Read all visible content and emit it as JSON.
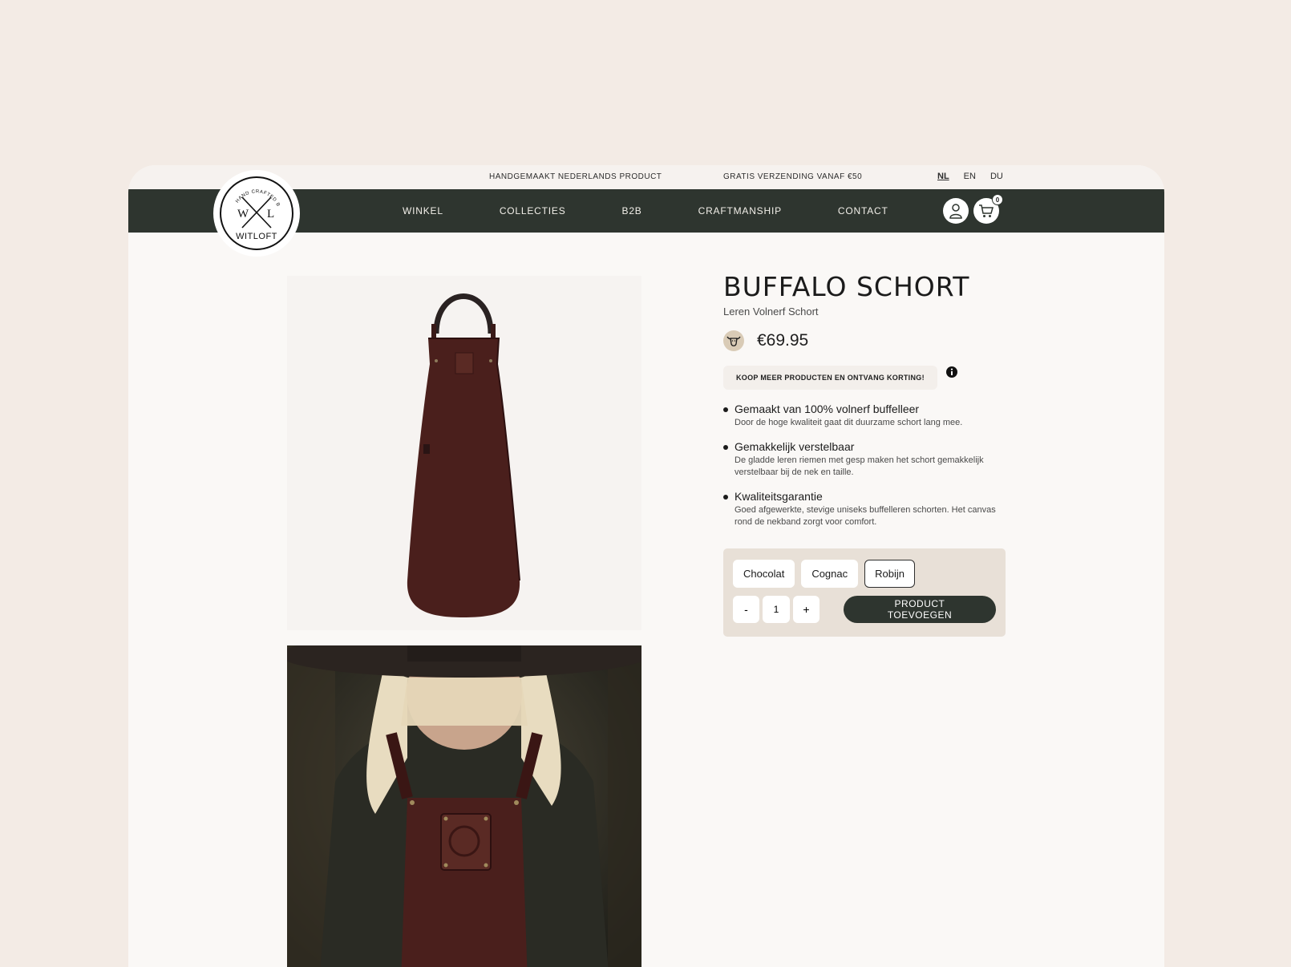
{
  "topbar": {
    "message_1": "HANDGEMAAKT NEDERLANDS PRODUCT",
    "message_2": "GRATIS VERZENDING VANAF €50",
    "languages": [
      "NL",
      "EN",
      "DU"
    ],
    "active_language": "NL"
  },
  "logo": {
    "arc_text": "HAND CRAFTED BY",
    "left_letter": "W",
    "right_letter": "L",
    "brand": "WITLOFT"
  },
  "nav": {
    "items": [
      "WINKEL",
      "COLLECTIES",
      "B2B",
      "CRAFTMANSHIP",
      "CONTACT"
    ],
    "cart_count": "0"
  },
  "product": {
    "title": "BUFFALO SCHORT",
    "subtitle": "Leren Volnerf Schort",
    "price": "€69.95",
    "discount_text": "KOOP MEER PRODUCTEN EN ONTVANG KORTING!",
    "features": [
      {
        "title": "Gemaakt van 100% volnerf buffelleer",
        "desc": "Door de hoge kwaliteit gaat dit duurzame schort lang mee."
      },
      {
        "title": "Gemakkelijk verstelbaar",
        "desc": "De gladde leren riemen met gesp maken het schort gemakkelijk verstelbaar bij de nek en taille."
      },
      {
        "title": "Kwaliteitsgarantie",
        "desc": "Goed afgewerkte, stevige uniseks buffelleren schorten. Het canvas rond de nekband zorgt voor comfort."
      }
    ],
    "colors": [
      "Chocolat",
      "Cognac",
      "Robijn"
    ],
    "selected_color": "Robijn",
    "quantity": "1",
    "minus_label": "-",
    "plus_label": "+",
    "add_to_cart_label": "PRODUCT TOEVOEGEN"
  },
  "theme": {
    "nav_bg": "#2e352f",
    "page_bg": "#f3ebe5",
    "leather": "#4a1f1c"
  }
}
